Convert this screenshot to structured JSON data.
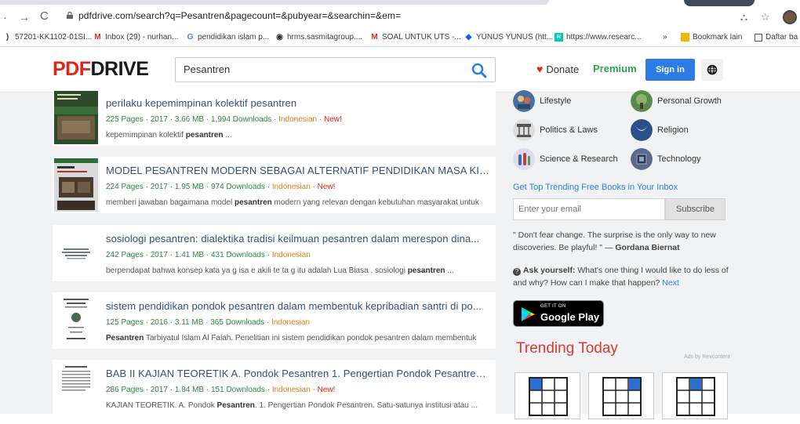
{
  "browser": {
    "url": "pdfdrive.com/search?q=Pesantren&pagecount=&pubyear=&searchin=&em=",
    "bookmarks": [
      {
        "label": "57201-KK1102-01SI...",
        "icon": "page-icon"
      },
      {
        "label": "Inbox (29) - nurhan...",
        "icon": "gmail-icon"
      },
      {
        "label": "pendidikan islam p...",
        "icon": "google-icon"
      },
      {
        "label": "hrms.sasmitagroup....",
        "icon": "globe-icon"
      },
      {
        "label": "SOAL UNTUK UTS -...",
        "icon": "gmail-icon"
      },
      {
        "label": "YUNUS YUNUS (htt...",
        "icon": "dropbox-icon"
      },
      {
        "label": "https://www.researc...",
        "icon": "researchgate-icon"
      },
      {
        "label": "»",
        "icon": ""
      },
      {
        "label": "Bookmark lain",
        "icon": "folder-icon"
      },
      {
        "label": "Daftar ba",
        "icon": "reading-list-icon"
      }
    ]
  },
  "header": {
    "logo_pdf": "PDF",
    "logo_drive": "DRIVE",
    "search_value": "Pesantren",
    "donate_label": "Donate",
    "premium_label": "Premium",
    "signin_label": "Sign in"
  },
  "results": [
    {
      "title": "perilaku kepemimpinan kolektif pesantren",
      "pages": "225 Pages",
      "year": "2017",
      "size": "3.66 MB",
      "downloads": "1,994 Downloads",
      "language": "Indonesian",
      "new_label": "New!",
      "desc_pre": "kepemimpinan kolektif ",
      "desc_bold": "pesantren",
      "desc_post": " ..."
    },
    {
      "title": "MODEL PESANTREN MODERN SEBAGAI ALTERNATIF PENDIDIKAN MASA KINI DA...",
      "pages": "224 Pages",
      "year": "2017",
      "size": "1.95 MB",
      "downloads": "974 Downloads",
      "language": "Indonesian",
      "new_label": "New!",
      "desc_pre": "memberi jawaban bagaimana model ",
      "desc_bold": "pesantren",
      "desc_post": " modern yang relevan dengan kebutuhan masyarakat untuk"
    },
    {
      "title": "sosiologi pesantren: dialektika tradisi keilmuan pesantren dalam merespon dina...",
      "pages": "242 Pages",
      "year": "2017",
      "size": "1.41 MB",
      "downloads": "431 Downloads",
      "language": "Indonesian",
      "new_label": "",
      "desc_pre": "berpendapat bahwa konsep kata ya g isa e akili te ta g itu adalah Lua Biasa . sosiologi ",
      "desc_bold": "pesantren",
      "desc_post": " ..."
    },
    {
      "title": "sistem pendidikan pondok pesantren dalam membentuk kepribadian santri di po...",
      "pages": "125 Pages",
      "year": "2016",
      "size": "3.11 MB",
      "downloads": "365 Downloads",
      "language": "Indonesian",
      "new_label": "",
      "desc_pre": "",
      "desc_bold": "Pesantren",
      "desc_post": " Tarbiyatul Islam Al Falah. Penelitian ini  sistem pendidikan pondok pesantren dalam membentuk"
    },
    {
      "title": "BAB II KAJIAN TEORETIK A. Pondok Pesantren 1. Pengertian Pondok Pesantren S...",
      "pages": "286 Pages",
      "year": "2017",
      "size": "1.84 MB",
      "downloads": "151 Downloads",
      "language": "Indonesian",
      "new_label": "New!",
      "desc_pre": "KAJIAN TEORETIK. A. Pondok ",
      "desc_bold": "Pesantren",
      "desc_post": ". 1. Pengertian Pondok Pesantren. Satu-satunya institusi atau ..."
    }
  ],
  "sidebar": {
    "categories": [
      {
        "label": "Lifestyle",
        "icon": "lifestyle-icon"
      },
      {
        "label": "Personal Growth",
        "icon": "personal-growth-icon"
      },
      {
        "label": "Politics & Laws",
        "icon": "politics-icon"
      },
      {
        "label": "Religion",
        "icon": "religion-icon"
      },
      {
        "label": "Science & Research",
        "icon": "science-icon"
      },
      {
        "label": "Technology",
        "icon": "technology-icon"
      }
    ],
    "trending_link": "Get Top Trending Free Books in Your Inbox",
    "email_placeholder": "Enter your email",
    "subscribe_label": "Subscribe",
    "quote_text": "\" Don't fear change. The surprise is the only way to new discoveries. Be playful! \" — ",
    "quote_author": "Gordana Biernat",
    "ask_label": "Ask yourself:",
    "ask_text": " What's one thing I would like to do less of and why? How can I make that happen? ",
    "ask_next": "Next",
    "gplay_get": "GET IT ON",
    "gplay_name": "Google Play",
    "trending_title": "Trending Today",
    "ads_by": "Ads by Revcontent"
  }
}
